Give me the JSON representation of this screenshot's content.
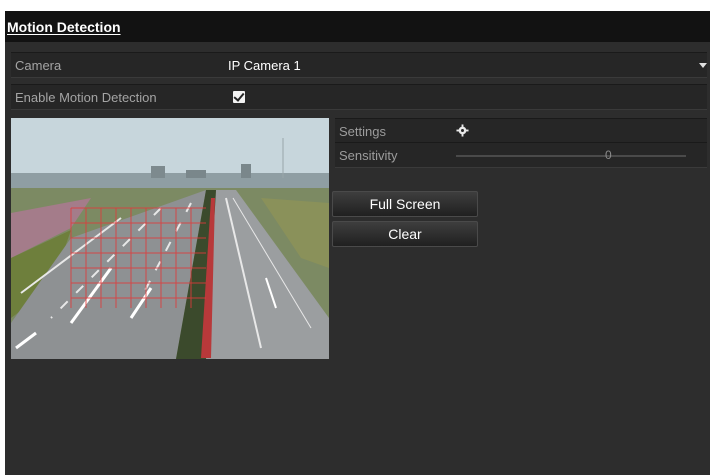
{
  "window": {
    "title": "Motion Detection"
  },
  "camera": {
    "label": "Camera",
    "value": "IP Camera 1"
  },
  "enable_motion": {
    "label": "Enable Motion Detection",
    "checked": true
  },
  "settings": {
    "label": "Settings",
    "icon": "gear-icon"
  },
  "sensitivity": {
    "label": "Sensitivity",
    "value": "0"
  },
  "buttons": {
    "full_screen": "Full Screen",
    "clear": "Clear"
  },
  "preview": {
    "description_icon": "camera-preview-image"
  },
  "colors": {
    "background": "#2d2d2d",
    "title_bar": "#121212",
    "grid": "#e03a3a"
  }
}
